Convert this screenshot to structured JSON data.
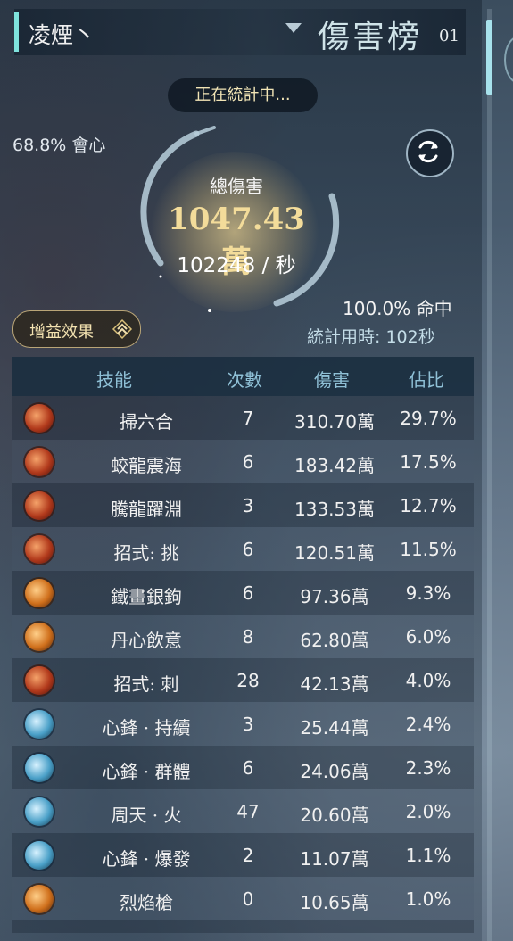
{
  "header": {
    "player_name": "凌煙丶",
    "board_title": "傷害榜",
    "board_number": "01"
  },
  "status": "正在統計中...",
  "summary": {
    "crit_rate": "68.8% 會心",
    "total_label": "總傷害",
    "total_damage": "1047.43萬",
    "dps": "102248 / 秒",
    "hit_rate": "100.0% 命中",
    "duration": "統計用時: 102秒"
  },
  "buff_button": {
    "label": "增益效果"
  },
  "table": {
    "columns": [
      "技能",
      "次數",
      "傷害",
      "佔比"
    ],
    "rows": [
      {
        "icon": "red",
        "name": "掃六合",
        "count": "7",
        "damage": "310.70萬",
        "pct": "29.7%"
      },
      {
        "icon": "red",
        "name": "蛟龍震海",
        "count": "6",
        "damage": "183.42萬",
        "pct": "17.5%"
      },
      {
        "icon": "red",
        "name": "騰龍躍淵",
        "count": "3",
        "damage": "133.53萬",
        "pct": "12.7%"
      },
      {
        "icon": "red",
        "name": "招式: 挑",
        "count": "6",
        "damage": "120.51萬",
        "pct": "11.5%"
      },
      {
        "icon": "orange",
        "name": "鐵畫銀鉤",
        "count": "6",
        "damage": "97.36萬",
        "pct": "9.3%"
      },
      {
        "icon": "orange",
        "name": "丹心飲意",
        "count": "8",
        "damage": "62.80萬",
        "pct": "6.0%"
      },
      {
        "icon": "red",
        "name": "招式: 刺",
        "count": "28",
        "damage": "42.13萬",
        "pct": "4.0%"
      },
      {
        "icon": "blue",
        "name": "心鋒 · 持續",
        "count": "3",
        "damage": "25.44萬",
        "pct": "2.4%"
      },
      {
        "icon": "blue",
        "name": "心鋒 · 群體",
        "count": "6",
        "damage": "24.06萬",
        "pct": "2.3%"
      },
      {
        "icon": "blue",
        "name": "周天 · 火",
        "count": "47",
        "damage": "20.60萬",
        "pct": "2.0%"
      },
      {
        "icon": "blue",
        "name": "心鋒 · 爆發",
        "count": "2",
        "damage": "11.07萬",
        "pct": "1.1%"
      },
      {
        "icon": "orange",
        "name": "烈焰槍",
        "count": "0",
        "damage": "10.65萬",
        "pct": "1.0%"
      }
    ]
  },
  "colors": {
    "accent": "#7fe3dd",
    "gold": "#f3dc9a",
    "header_text": "#8fc0d6"
  }
}
